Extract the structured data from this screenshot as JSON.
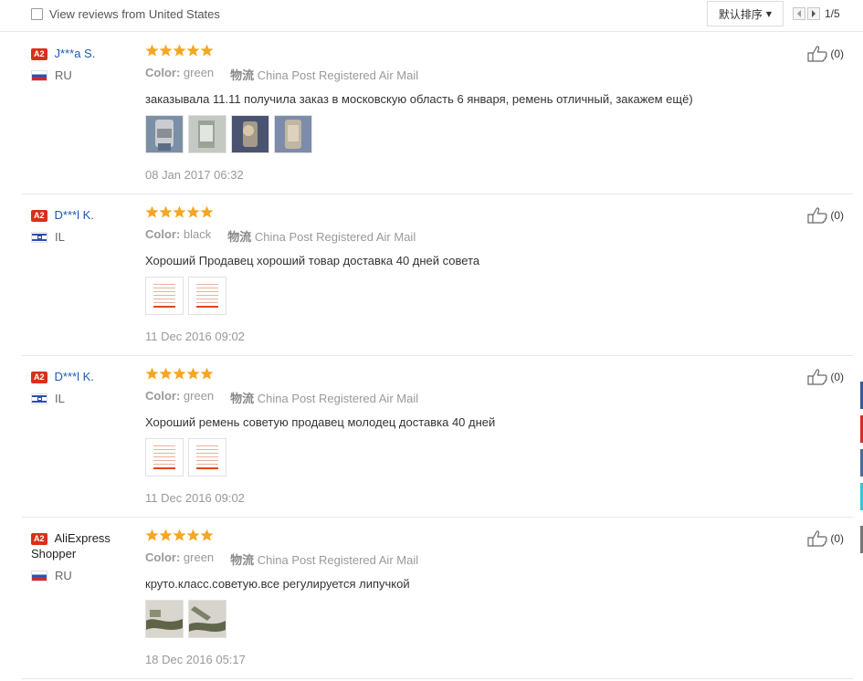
{
  "filter": {
    "label": "View reviews from United States",
    "checked": false
  },
  "sort": {
    "label": "默认排序"
  },
  "pager": {
    "text": "1/5"
  },
  "reviews": [
    {
      "level": "A2",
      "name": "J***a S.",
      "country": "RU",
      "rating": 5,
      "color_label": "Color:",
      "color": "green",
      "ship_label": "物流",
      "shipping": "China Post Registered Air Mail",
      "text": "заказывала 11.11 получила заказ в московскую область 6 января, ремень отличный, закажем ещё)",
      "date": "08 Jan 2017 06:32",
      "helpful": "(0)"
    },
    {
      "level": "A2",
      "name": "D***l K.",
      "country": "IL",
      "rating": 5,
      "color_label": "Color:",
      "color": "black",
      "ship_label": "物流",
      "shipping": "China Post Registered Air Mail",
      "text": "Хороший Продавец хороший товар доставка 40 дней совета",
      "date": "11 Dec 2016 09:02",
      "helpful": "(0)"
    },
    {
      "level": "A2",
      "name": "D***l K.",
      "country": "IL",
      "rating": 5,
      "color_label": "Color:",
      "color": "green",
      "ship_label": "物流",
      "shipping": "China Post Registered Air Mail",
      "text": "Хороший ремень советую продавец молодец доставка 40 дней",
      "date": "11 Dec 2016 09:02",
      "helpful": "(0)"
    },
    {
      "level": "A2",
      "name": "AliExpress Shopper",
      "country": "RU",
      "rating": 5,
      "color_label": "Color:",
      "color": "green",
      "ship_label": "物流",
      "shipping": "China Post Registered Air Mail",
      "text": "круто.класс.советую.все регулируется липучкой",
      "date": "18 Dec 2016 05:17",
      "helpful": "(0)"
    }
  ],
  "colors": {
    "star": "#f5a623",
    "link": "#1a5bb5",
    "level_badge": "#d9301a"
  }
}
